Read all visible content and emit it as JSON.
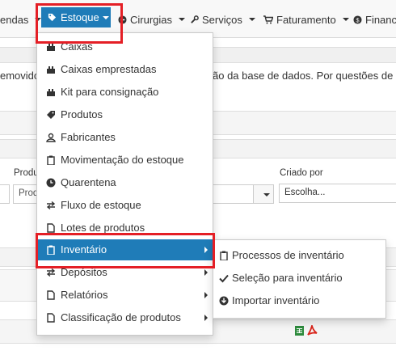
{
  "nav": {
    "vendas_partial": "endas",
    "estoque": "Estoque",
    "cirurgias": "Cirurgias",
    "servicos": "Serviços",
    "faturamento": "Faturamento",
    "financeiro_partial": "Financ"
  },
  "page": {
    "notice_left": "emovidos",
    "notice_right": "ão da base de dados. Por questões de",
    "produto_label": "Produt",
    "produto_placeholder": "Produ",
    "criado_por_label": "Criado por",
    "criado_por_value": "Escolha..."
  },
  "menu": {
    "items": [
      {
        "label": "Caixas",
        "icon": "box-icon"
      },
      {
        "label": "Caixas emprestadas",
        "icon": "box-icon"
      },
      {
        "label": "Kit para consignação",
        "icon": "box-icon"
      },
      {
        "label": "Produtos",
        "icon": "tag-icon"
      },
      {
        "label": "Fabricantes",
        "icon": "user-icon"
      },
      {
        "label": "Movimentação do estoque",
        "icon": "clipboard-icon"
      },
      {
        "label": "Quarentena",
        "icon": "clock-icon"
      },
      {
        "label": "Fluxo de estoque",
        "icon": "exchange-icon"
      },
      {
        "label": "Lotes de produtos",
        "icon": "file-icon"
      },
      {
        "label": "Inventário",
        "icon": "clipboard-icon"
      },
      {
        "label": "Depósitos",
        "icon": "exchange-icon"
      },
      {
        "label": "Relatórios",
        "icon": "file-icon"
      },
      {
        "label": "Classificação de produtos",
        "icon": "file-icon"
      }
    ],
    "active_item": "Inventário"
  },
  "submenu": {
    "items": [
      {
        "label": "Processos de inventário",
        "icon": "clipboard-icon"
      },
      {
        "label": "Seleção para inventário",
        "icon": "check-icon"
      },
      {
        "label": "Importar inventário",
        "icon": "download-icon"
      }
    ]
  },
  "colors": {
    "accent": "#1f7cb8",
    "highlight_border": "#e41f26"
  }
}
